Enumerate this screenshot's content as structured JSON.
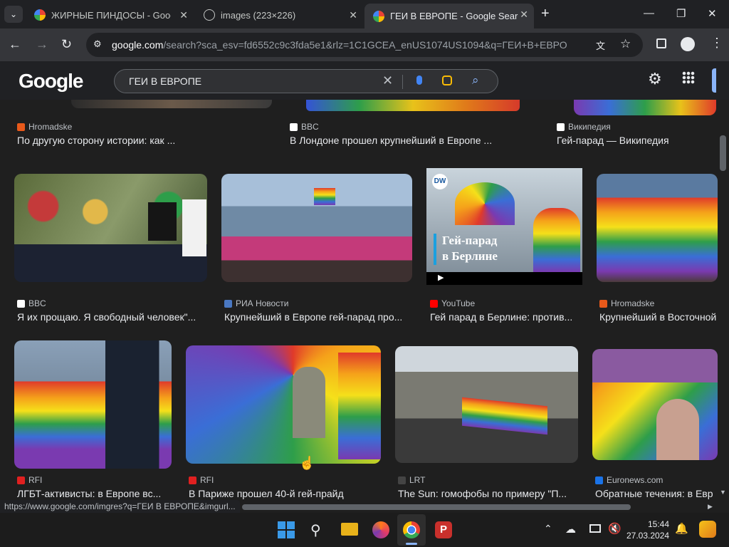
{
  "tabs": [
    {
      "title": "ЖИРНЫЕ ПИНДОСЫ - Google",
      "favicon": "google-g-icon"
    },
    {
      "title": "images (223×226)",
      "favicon": "globe-icon"
    },
    {
      "title": "ГЕИ В ЕВРОПЕ - Google Search",
      "favicon": "google-g-icon"
    }
  ],
  "address": {
    "host": "google.com",
    "rest": "/search?sca_esv=fd6552c9c3fda5e1&rlz=1C1GCEA_enUS1074US1094&q=ГЕИ+В+ЕВРОПЕ&ud..."
  },
  "google": {
    "logo": "Google",
    "query": "ГЕИ В ЕВРОПЕ"
  },
  "row0": [
    {
      "source": "Hromadske",
      "caption": "По другую сторону истории: как ...",
      "icon_color": "#e8591a"
    },
    {
      "source": "BBC",
      "caption": "В Лондоне прошел крупнейший в Европе ...",
      "icon_color": "#ffffff"
    },
    {
      "source": "Википедия",
      "caption": "Гей-парад — Википедия",
      "icon_color": "#ffffff"
    }
  ],
  "row1": [
    {
      "source": "BBC",
      "caption": "Я их прощаю. Я свободный человек\"...",
      "icon_color": "#ffffff"
    },
    {
      "source": "РИА Новости",
      "caption": "Крупнейший в Европе гей-парад про...",
      "icon_color": "#4a78c2"
    },
    {
      "source": "YouTube",
      "caption": "Гей парад в Берлине: против...",
      "icon_color": "#ff0000"
    },
    {
      "source": "Hromadske",
      "caption": "Крупнейший в Восточной",
      "icon_color": "#e8591a"
    }
  ],
  "row2": [
    {
      "source": "RFI",
      "caption": "ЛГБТ-активисты: в Европе вс...",
      "icon_color": "#e02020"
    },
    {
      "source": "RFI",
      "caption": "В Париже прошел 40-й гей-прайд",
      "icon_color": "#e02020"
    },
    {
      "source": "LRT",
      "caption": "The Sun: гомофобы по примеру \"П...",
      "icon_color": "#444444"
    },
    {
      "source": "Euronews.com",
      "caption": "Обратные течения: в Евр",
      "icon_color": "#1a73e8"
    }
  ],
  "overlay": {
    "dw": "DW",
    "line1": "Гей-парад",
    "line2": "в Берлине"
  },
  "status_url": "https://www.google.com/imgres?q=ГЕИ В ЕВРОПЕ&imgurl...",
  "clock": {
    "time": "15:44",
    "date": "27.03.2024"
  },
  "colors": {
    "accent": "#8ab4f8",
    "bg": "#1f1f1f"
  }
}
